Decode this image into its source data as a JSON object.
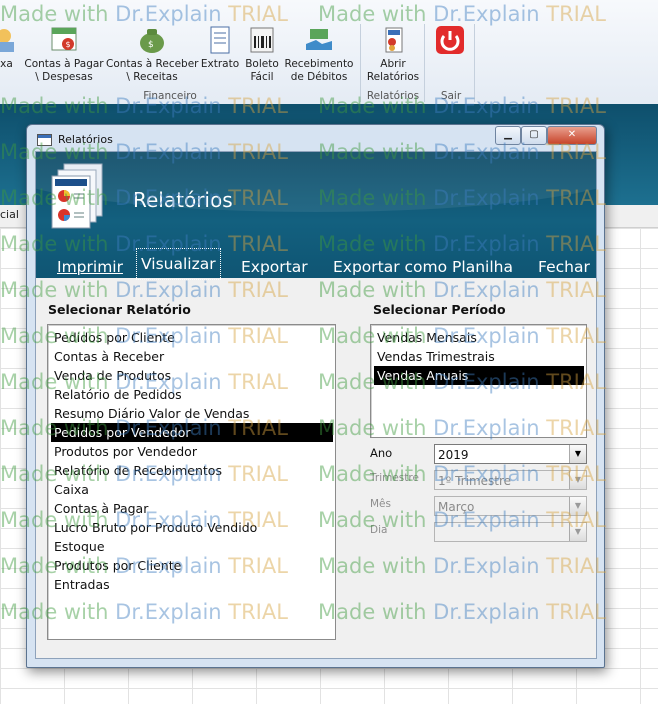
{
  "ribbon": {
    "buttons": [
      {
        "label": "ixa"
      },
      {
        "label": "Contas à Pagar\n\\ Despesas"
      },
      {
        "label": "Contas à Receber\n\\ Receitas"
      },
      {
        "label": "Extrato"
      },
      {
        "label": "Boleto\nFácil"
      },
      {
        "label": "Recebimento\nde Débitos"
      },
      {
        "label": "Abrir\nRelatórios"
      },
      {
        "label": ""
      }
    ],
    "groups": {
      "financeiro": "Financeiro",
      "relatorios": "Relatórios",
      "sair": "Sair"
    }
  },
  "background": {
    "tab_label": "cial"
  },
  "dialog": {
    "window_title": "Relatórios",
    "header_title": "Relatórios",
    "menu": {
      "imprimir": "Imprimir",
      "visualizar": "Visualizar",
      "exportar": "Exportar",
      "exportar_planilha": "Exportar como Planilha",
      "fechar": "Fechar"
    },
    "report_section_title": "Selecionar Relatório",
    "reports": [
      "Pedidos por Cliente",
      "Contas à Receber",
      "Venda de Produtos",
      "Relatório de Pedidos",
      "Resumo Diário Valor de Vendas",
      "Pedidos por Vendedor",
      "Produtos por Vendedor",
      "Relatório de Recebimentos",
      "Caixa",
      "Contas à Pagar",
      "Lucro Bruto por Produto Vendido",
      "Estoque",
      "Produtos por Cliente",
      "Entradas"
    ],
    "selected_report": "Pedidos por Vendedor",
    "period_section_title": "Selecionar Período",
    "periods": [
      "Vendas Mensais",
      "Vendas Trimestrais",
      "Vendas Anuais"
    ],
    "selected_period": "Vendas Anuais",
    "fields": {
      "ano_label": "Ano",
      "ano_value": "2019",
      "trimestre_label": "Trimestre",
      "trimestre_value": "1º Trimestre",
      "mes_label": "Mês",
      "mes_value": "Março",
      "dia_label": "Dia",
      "dia_value": ""
    }
  },
  "watermark": {
    "part1": "Made with ",
    "part2": "Dr.Explain ",
    "part3": "TRIAL"
  },
  "colors": {
    "header_teal": "#13607f",
    "selection": "#000000",
    "close_red": "#c7432a"
  }
}
